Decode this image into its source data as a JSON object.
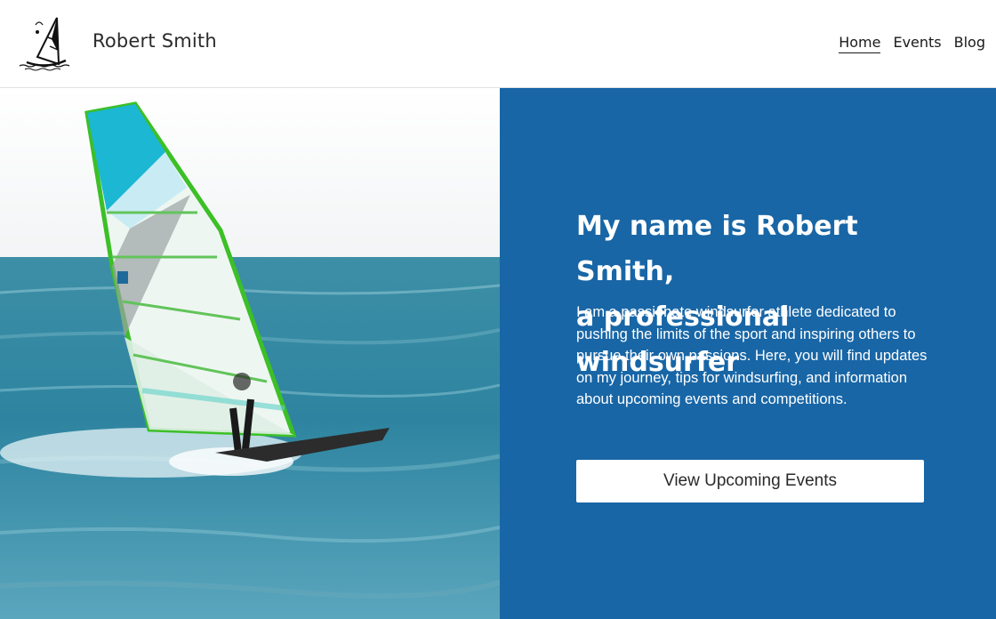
{
  "header": {
    "logo_icon": "windsurfer-logo-icon",
    "site_name": "Robert Smith",
    "nav": [
      {
        "label": "Home",
        "active": true
      },
      {
        "label": "Events",
        "active": false
      },
      {
        "label": "Blog",
        "active": false
      }
    ]
  },
  "hero": {
    "image_icon": "windsurfer-photo",
    "headline_line1": "My name is Robert Smith,",
    "headline_line2": "a professional windsurfer",
    "intro": "I am a passionate windsurfer athlete dedicated to pushing the limits of the sport and inspiring others to pursue their own passions. Here, you will find updates on my journey, tips for windsurfing, and information about upcoming events and competitions.",
    "cta_label": "View Upcoming Events"
  },
  "colors": {
    "panel_bg": "#1866a6",
    "text_on_panel": "#ffffff",
    "sail_green": "#3fbf2a",
    "sail_cyan": "#1bb7d3",
    "sea": "#2e84a0"
  }
}
